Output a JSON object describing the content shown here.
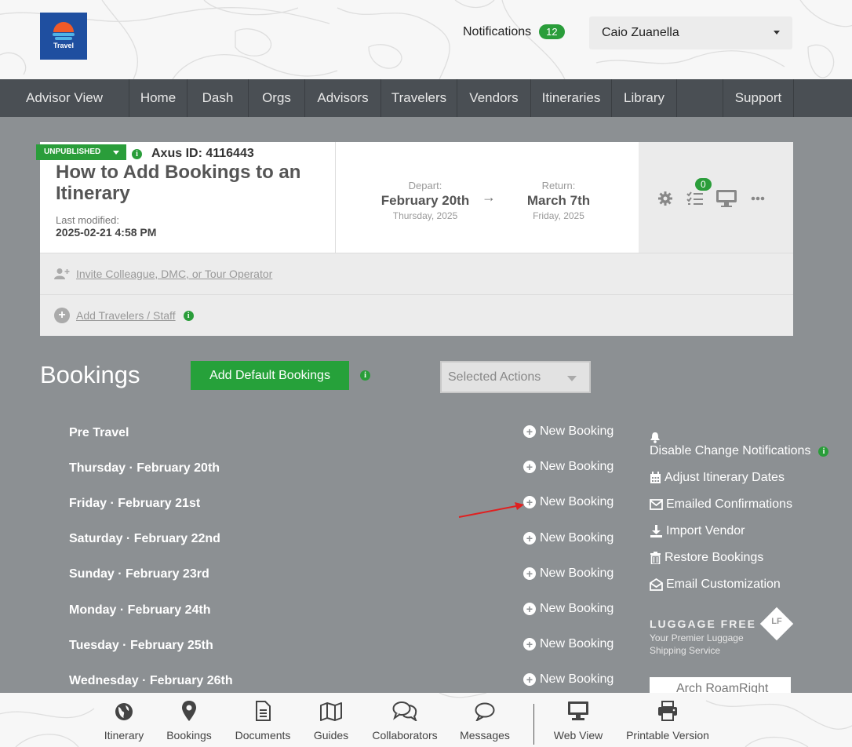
{
  "header": {
    "logo_text": "Travel",
    "notifications_label": "Notifications",
    "notifications_count": "12",
    "user_name": "Caio Zuanella"
  },
  "nav": {
    "items": [
      "Advisor View",
      "Home",
      "Dash",
      "Orgs",
      "Advisors",
      "Travelers",
      "Vendors",
      "Itineraries",
      "Library",
      "",
      "Support"
    ]
  },
  "itinerary": {
    "status": "UNPUBLISHED",
    "axus_id": "Axus ID: 4116443",
    "title": "How to Add Bookings to an Itinerary",
    "last_modified_label": "Last modified:",
    "last_modified_value": "2025-02-21 4:58 PM",
    "depart_label": "Depart:",
    "depart_date": "February 20th",
    "depart_day": "Thursday, 2025",
    "return_label": "Return:",
    "return_date": "March 7th",
    "return_day": "Friday, 2025",
    "arrow": "→",
    "tasks_badge": "0",
    "invite_link": "Invite Colleague, DMC, or Tour Operator",
    "add_travelers_link": "Add Travelers / Staff",
    "info_glyph": "i"
  },
  "bookings": {
    "title": "Bookings",
    "add_default_label": "Add Default Bookings",
    "selected_actions": "Selected Actions",
    "new_booking_label": "New Booking",
    "days": [
      "Pre Travel",
      "Thursday · February 20th",
      "Friday · February 21st",
      "Saturday · February 22nd",
      "Sunday · February 23rd",
      "Monday · February 24th",
      "Tuesday · February 25th",
      "Wednesday · February 26th"
    ]
  },
  "sidebar": {
    "disable_notifications": "Disable Change Notifications",
    "adjust_dates": "Adjust Itinerary Dates",
    "emailed_confirmations": "Emailed Confirmations",
    "import_vendor": "Import Vendor",
    "restore_bookings": "Restore Bookings",
    "email_customization": "Email Customization",
    "luggage_title": "LUGGAGE FREE",
    "luggage_sub": "Your Premier Luggage Shipping Service",
    "luggage_mark": "LF",
    "arch_text": "Arch  RoamRight"
  },
  "bottom": {
    "items": [
      "Itinerary",
      "Bookings",
      "Documents",
      "Guides",
      "Collaborators",
      "Messages",
      "Web View",
      "Printable Version"
    ]
  },
  "colors": {
    "accent_green": "#2a9d3a",
    "nav_bg": "#4a4f54",
    "page_bg": "#8c9093",
    "annotation_red": "#e02020"
  }
}
